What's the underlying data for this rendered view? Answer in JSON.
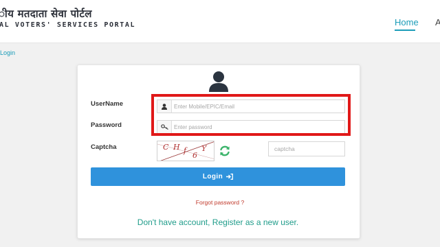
{
  "header": {
    "title_hindi": "ीय मतदाता सेवा पोर्टल",
    "title_english": "AL VOTERS' SERVICES PORTAL",
    "nav": {
      "home": "Home",
      "partial": "A"
    }
  },
  "breadcrumb": {
    "login": "Login"
  },
  "form": {
    "username_label": "UserName",
    "username_placeholder": "Enter Mobile/EPIC/Email",
    "password_label": "Password",
    "password_placeholder": "Enter password",
    "captcha_label": "Captcha",
    "captcha_text": [
      "C",
      "H",
      "f",
      "6",
      "Y"
    ],
    "captcha_placeholder": "captcha",
    "login_button": "Login",
    "forgot_password": "Forgot password ?",
    "register_text": "Don't have account, Register as a new user."
  },
  "colors": {
    "accent": "#1a9cb8",
    "button": "#2f92dc",
    "highlight": "#e01818",
    "forgot": "#c0392b",
    "register": "#1f9c8a",
    "refresh": "#3bb36a"
  },
  "icons": [
    "user-avatar-icon",
    "user-icon",
    "key-icon",
    "refresh-icon",
    "sign-in-icon"
  ]
}
